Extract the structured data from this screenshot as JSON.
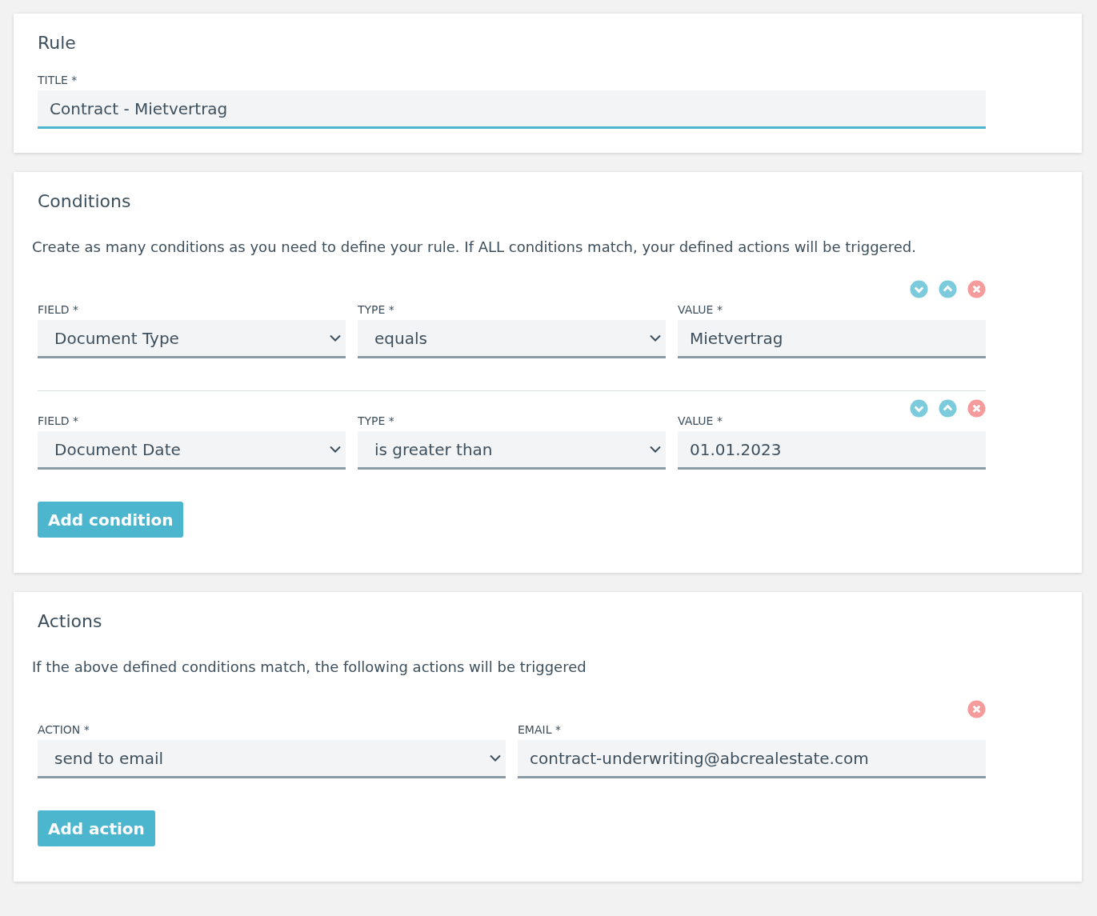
{
  "rule": {
    "heading": "Rule",
    "title_field": {
      "label": "TITLE *",
      "value": "Contract - Mietvertrag",
      "focused": true
    }
  },
  "conditions": {
    "heading": "Conditions",
    "description": "Create as many conditions as you need to define your rule. If ALL conditions match, your defined actions will be triggered.",
    "rows": [
      {
        "fields": [
          {
            "kind": "select",
            "label": "FIELD *",
            "value": "Document Type"
          },
          {
            "kind": "select",
            "label": "TYPE *",
            "value": "equals"
          },
          {
            "kind": "input",
            "label": "VALUE *",
            "value": "Mietvertrag"
          }
        ]
      },
      {
        "fields": [
          {
            "kind": "select",
            "label": "FIELD *",
            "value": "Document Date"
          },
          {
            "kind": "select",
            "label": "TYPE *",
            "value": "is greater than"
          },
          {
            "kind": "input",
            "label": "VALUE *",
            "value": "01.01.2023"
          }
        ]
      }
    ],
    "add_button": "Add condition"
  },
  "actions": {
    "heading": "Actions",
    "description": "If the above defined conditions match, the following actions will be triggered",
    "rows": [
      {
        "fields": [
          {
            "kind": "select",
            "label": "ACTION *",
            "value": "send to email"
          },
          {
            "kind": "input",
            "label": "EMAIL *",
            "value": "contract-underwriting@abcrealestate.com"
          }
        ]
      }
    ],
    "add_button": "Add action"
  }
}
